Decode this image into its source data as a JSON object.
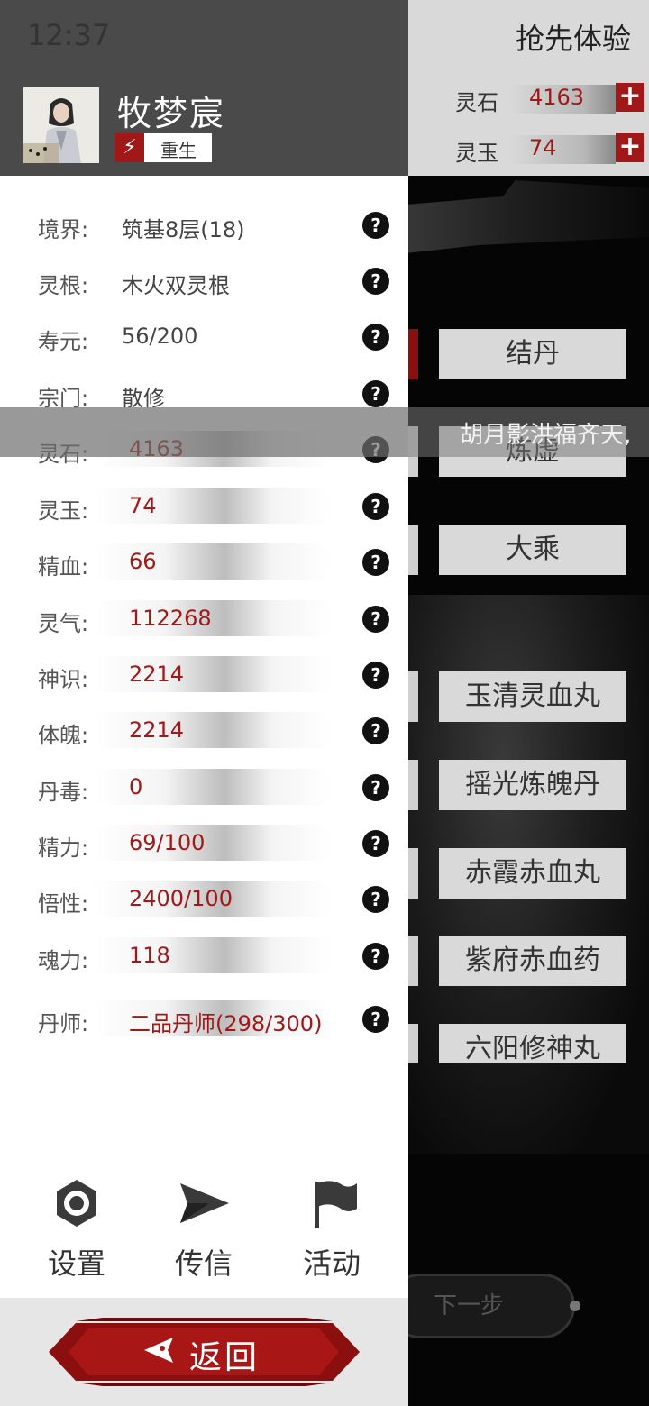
{
  "status_bar": {
    "time": "12:37"
  },
  "background": {
    "title": "抢先体验",
    "resources": [
      {
        "label": "灵石",
        "value": "4163"
      },
      {
        "label": "灵玉",
        "value": "74"
      }
    ],
    "realm_buttons": [
      "结丹",
      "炼虚",
      "大乘"
    ],
    "pill_buttons": [
      "玉清灵血丸",
      "摇光炼魄丹",
      "赤霞赤血丸",
      "紫府赤血药",
      "六阳修神丸"
    ],
    "marquee": "胡月影洪福齐天,",
    "next_button": "下一步"
  },
  "player": {
    "name": "牧梦宸",
    "badge": "重生"
  },
  "stats": [
    {
      "label": "境界:",
      "value": "筑基8层(18)"
    },
    {
      "label": "灵根:",
      "value": "木火双灵根"
    },
    {
      "label": "寿元:",
      "value": "56/200"
    },
    {
      "label": "宗门:",
      "value": "散修"
    },
    {
      "label": "灵石:",
      "value": "4163"
    },
    {
      "label": "灵玉:",
      "value": "74"
    },
    {
      "label": "精血:",
      "value": "66"
    },
    {
      "label": "灵气:",
      "value": "112268"
    },
    {
      "label": "神识:",
      "value": "2214"
    },
    {
      "label": "体魄:",
      "value": "2214"
    },
    {
      "label": "丹毒:",
      "value": "0"
    },
    {
      "label": "精力:",
      "value": "69/100"
    },
    {
      "label": "悟性:",
      "value": "2400/100"
    },
    {
      "label": "魂力:",
      "value": "118"
    },
    {
      "label": "丹师:",
      "value": "二品丹师(298/300)"
    }
  ],
  "help_glyph": "?",
  "nav": [
    {
      "label": "设置",
      "icon": "gear-icon"
    },
    {
      "label": "传信",
      "icon": "send-icon"
    },
    {
      "label": "活动",
      "icon": "flag-icon"
    }
  ],
  "back_button": "返回",
  "colors": {
    "accent_red": "#a01818",
    "header_gray": "#4a4a4a"
  }
}
